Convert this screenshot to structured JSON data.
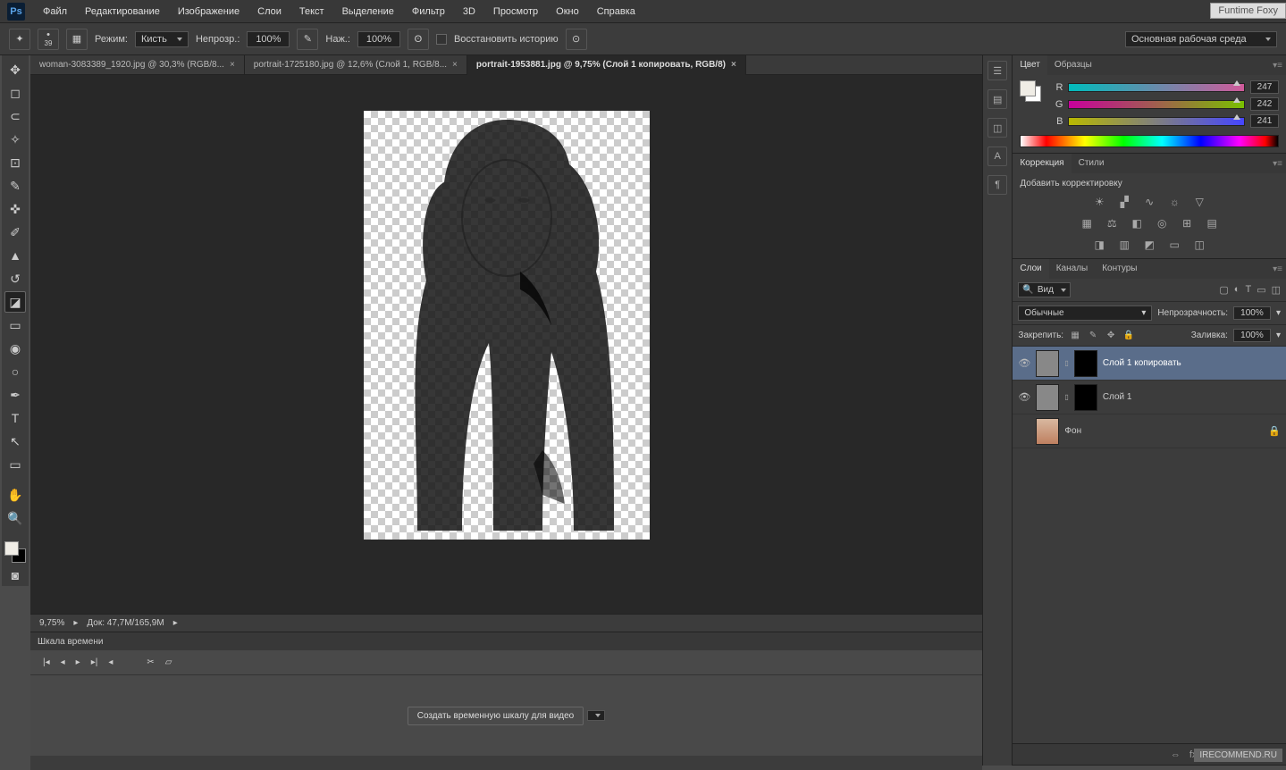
{
  "watermark": "Funtime Foxy",
  "watermark2": "IRECOMMEND.RU",
  "menu": [
    "Файл",
    "Редактирование",
    "Изображение",
    "Слои",
    "Текст",
    "Выделение",
    "Фильтр",
    "3D",
    "Просмотр",
    "Окно",
    "Справка"
  ],
  "options": {
    "brush_size": "39",
    "mode_lbl": "Режим:",
    "mode_val": "Кисть",
    "opacity_lbl": "Непрозр.:",
    "opacity_val": "100%",
    "flow_lbl": "Наж.:",
    "flow_val": "100%",
    "restore_lbl": "Восстановить историю",
    "workspace": "Основная рабочая среда"
  },
  "tabs": [
    {
      "label": "woman-3083389_1920.jpg @ 30,3% (RGB/8...",
      "active": false
    },
    {
      "label": "portrait-1725180.jpg @ 12,6% (Слой 1, RGB/8...",
      "active": false
    },
    {
      "label": "portrait-1953881.jpg @ 9,75% (Слой 1 копировать, RGB/8)",
      "active": true
    }
  ],
  "status": {
    "zoom": "9,75%",
    "doc": "Док: 47,7M/165,9M"
  },
  "timeline": {
    "title": "Шкала времени",
    "button": "Создать временную шкалу для видео"
  },
  "color_panel": {
    "tabs": [
      "Цвет",
      "Образцы"
    ],
    "r": "247",
    "g": "242",
    "b": "241"
  },
  "adjustments": {
    "tabs": [
      "Коррекция",
      "Стили"
    ],
    "add": "Добавить корректировку"
  },
  "layers_panel": {
    "tabs": [
      "Слои",
      "Каналы",
      "Контуры"
    ],
    "kind": "Вид",
    "blend": "Обычные",
    "opacity_lbl": "Непрозрачность:",
    "opacity": "100%",
    "lock_lbl": "Закрепить:",
    "fill_lbl": "Заливка:",
    "fill": "100%",
    "layers": [
      {
        "name": "Слой 1 копировать",
        "visible": true,
        "mask": true,
        "selected": true,
        "locked": false
      },
      {
        "name": "Слой 1",
        "visible": true,
        "mask": true,
        "selected": false,
        "locked": false
      },
      {
        "name": "Фон",
        "visible": false,
        "mask": false,
        "selected": false,
        "locked": true
      }
    ]
  }
}
